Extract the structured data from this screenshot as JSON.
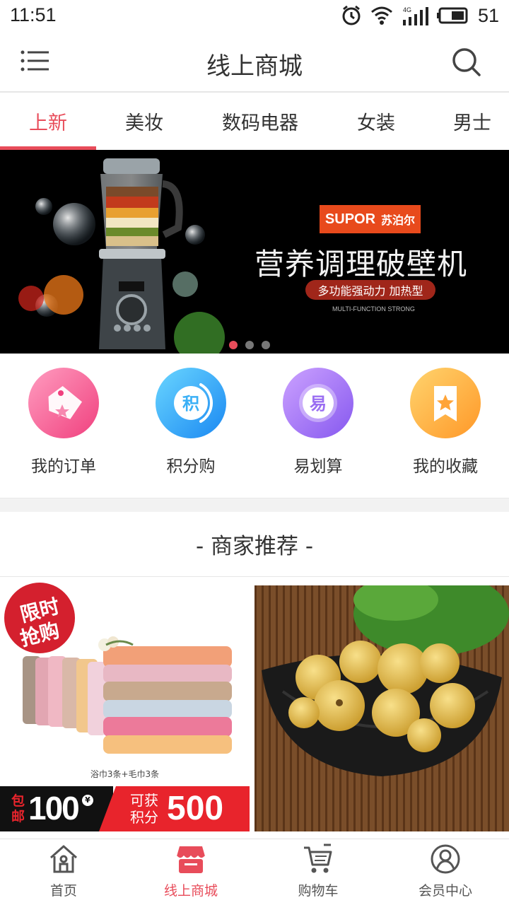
{
  "status_bar": {
    "time": "11:51",
    "network": "4G",
    "battery": "51"
  },
  "header": {
    "title": "线上商城",
    "menu_icon": "menu-icon",
    "search_icon": "search-icon"
  },
  "tabs": [
    {
      "label": "上新",
      "active": true
    },
    {
      "label": "美妆",
      "active": false
    },
    {
      "label": "数码电器",
      "active": false
    },
    {
      "label": "女装",
      "active": false
    },
    {
      "label": "男士",
      "active": false
    }
  ],
  "banner": {
    "brand_en": "SUPOR",
    "brand_cn": "苏泊尔",
    "headline": "营养调理破壁机",
    "subline": "多功能强动力 加热型",
    "small_text": "MULTI-FUNCTION STRONG",
    "slides": 3,
    "active_slide": 1
  },
  "quick_actions": [
    {
      "label": "我的订单",
      "icon": "tag-icon",
      "glyph": "",
      "colors": [
        "#ff8fb4",
        "#f2468a"
      ]
    },
    {
      "label": "积分购",
      "icon": "points-icon",
      "glyph": "积",
      "colors": [
        "#5fd0ff",
        "#1e8ff5"
      ]
    },
    {
      "label": "易划算",
      "icon": "bargain-icon",
      "glyph": "易",
      "colors": [
        "#c89cff",
        "#8a5cf0"
      ]
    },
    {
      "label": "我的收藏",
      "icon": "bookmark-star-icon",
      "glyph": "",
      "colors": [
        "#ffd06a",
        "#ff9a2e"
      ]
    }
  ],
  "recommend": {
    "title": "- 商家推荐 -",
    "products": [
      {
        "badge_line1": "限时",
        "badge_line2": "抢购",
        "caption": "浴巾3条+毛巾3条",
        "free_shipping": "包邮",
        "price": "100",
        "currency_mark": "¥",
        "earn_label": "可获积分",
        "points": "500"
      },
      {
        "image": "dried-figs-image"
      }
    ]
  },
  "bottom_nav": [
    {
      "label": "首页",
      "icon": "home-icon",
      "active": false
    },
    {
      "label": "线上商城",
      "icon": "shop-icon",
      "active": true
    },
    {
      "label": "购物车",
      "icon": "cart-icon",
      "active": false
    },
    {
      "label": "会员中心",
      "icon": "member-icon",
      "active": false
    }
  ],
  "colors": {
    "accent": "#e84c5a",
    "banner_brand": "#e84a1c"
  }
}
